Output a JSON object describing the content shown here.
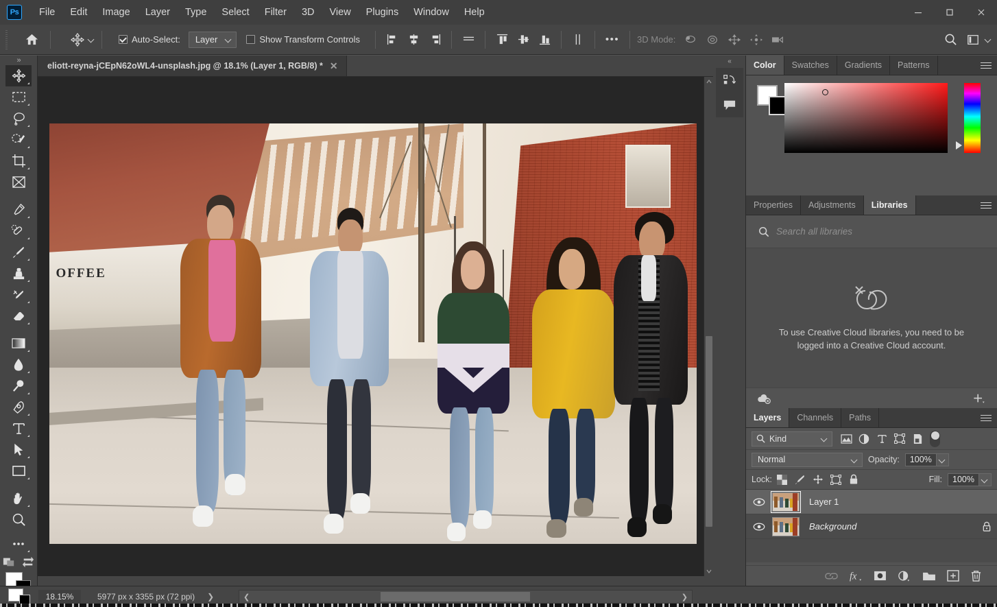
{
  "app": {
    "logo_text": "Ps",
    "menus": [
      "File",
      "Edit",
      "Image",
      "Layer",
      "Type",
      "Select",
      "Filter",
      "3D",
      "View",
      "Plugins",
      "Window",
      "Help"
    ],
    "window_controls": {
      "minimize": "minimize-icon",
      "maximize": "maximize-icon",
      "close": "close-icon"
    }
  },
  "options_bar": {
    "home_icon": "home-icon",
    "tool_icon": "move-tool-icon",
    "auto_select_label": "Auto-Select:",
    "auto_select_checked": true,
    "auto_select_value": "Layer",
    "show_transform_label": "Show Transform Controls",
    "show_transform_checked": false,
    "align_icons": [
      "align-left-edges-icon",
      "align-horizontal-centers-icon",
      "align-right-edges-icon",
      "distribute-horizontal-icon"
    ],
    "align_icons2": [
      "align-top-edges-icon",
      "align-vertical-centers-icon",
      "align-bottom-edges-icon",
      "distribute-vertical-icon"
    ],
    "more_label": "•••",
    "mode3d_label": "3D Mode:",
    "mode3d_icons": [
      "3d-orbit-icon",
      "3d-roll-icon",
      "3d-pan-icon",
      "3d-slide-icon",
      "3d-camera-icon"
    ],
    "search_icon": "search-icon",
    "workspace_icon": "workspace-switcher-icon",
    "workspace_chevron": "chevron-down-icon"
  },
  "document": {
    "tab_title": "eliott-reyna-jCEpN62oWL4-unsplash.jpg @ 18.1% (Layer 1, RGB/8) *",
    "close_icon": "close-icon"
  },
  "toolbar": {
    "grip": "»",
    "tools": [
      {
        "name": "move-tool",
        "icon": "move-icon",
        "active": true,
        "has_corner": true
      },
      {
        "name": "rectangular-marquee-tool",
        "icon": "marquee-icon",
        "active": false,
        "has_corner": true
      },
      {
        "name": "lasso-tool",
        "icon": "lasso-icon",
        "active": false,
        "has_corner": true
      },
      {
        "name": "object-selection-tool",
        "icon": "quick-selection-icon",
        "active": false,
        "has_corner": true
      },
      {
        "name": "crop-tool",
        "icon": "crop-icon",
        "active": false,
        "has_corner": true
      },
      {
        "name": "frame-tool",
        "icon": "frame-icon",
        "active": false,
        "has_corner": false
      },
      {
        "name": "eyedropper-tool",
        "icon": "eyedropper-icon",
        "active": false,
        "has_corner": true
      },
      {
        "name": "spot-healing-brush-tool",
        "icon": "healing-brush-icon",
        "active": false,
        "has_corner": true
      },
      {
        "name": "brush-tool",
        "icon": "brush-icon",
        "active": false,
        "has_corner": true
      },
      {
        "name": "clone-stamp-tool",
        "icon": "clone-stamp-icon",
        "active": false,
        "has_corner": true
      },
      {
        "name": "history-brush-tool",
        "icon": "history-brush-icon",
        "active": false,
        "has_corner": true
      },
      {
        "name": "eraser-tool",
        "icon": "eraser-icon",
        "active": false,
        "has_corner": true
      },
      {
        "name": "gradient-tool",
        "icon": "gradient-icon",
        "active": false,
        "has_corner": true
      },
      {
        "name": "blur-tool",
        "icon": "blur-drop-icon",
        "active": false,
        "has_corner": true
      },
      {
        "name": "dodge-tool",
        "icon": "dodge-icon",
        "active": false,
        "has_corner": true
      },
      {
        "name": "pen-tool",
        "icon": "pen-icon",
        "active": false,
        "has_corner": true
      },
      {
        "name": "type-tool",
        "icon": "type-t-icon",
        "active": false,
        "has_corner": true
      },
      {
        "name": "path-selection-tool",
        "icon": "path-arrow-icon",
        "active": false,
        "has_corner": true
      },
      {
        "name": "rectangle-tool",
        "icon": "rectangle-icon",
        "active": false,
        "has_corner": true
      },
      {
        "name": "hand-tool",
        "icon": "hand-icon",
        "active": false,
        "has_corner": true
      },
      {
        "name": "zoom-tool",
        "icon": "magnifier-icon",
        "active": false,
        "has_corner": false
      },
      {
        "name": "edit-toolbar",
        "icon": "ellipsis-icon",
        "active": false,
        "has_corner": true
      }
    ],
    "quick-mask": "quick-mask-icon",
    "screen-mode": "screen-mode-icon",
    "foreground_color": "#ffffff",
    "background_color": "#000000"
  },
  "canvas": {
    "zoom_display": "18.1%",
    "background_color": "#262626",
    "scroll_up_icon": "chevron-up-icon",
    "scroll_down_icon": "chevron-down-icon"
  },
  "rail": {
    "collapse_icon": "double-chevron-icon",
    "buttons": [
      "history-icon",
      "comments-icon"
    ]
  },
  "color_panel": {
    "tabs": [
      {
        "label": "Color",
        "active": true
      },
      {
        "label": "Swatches",
        "active": false
      },
      {
        "label": "Gradients",
        "active": false
      },
      {
        "label": "Patterns",
        "active": false
      }
    ],
    "menu_icon": "panel-menu-icon",
    "foreground_color": "#ffffff",
    "background_color": "#000000",
    "ramp_base_color": "#ff1a1a"
  },
  "libraries_panel": {
    "tabs": [
      {
        "label": "Properties",
        "active": false
      },
      {
        "label": "Adjustments",
        "active": false
      },
      {
        "label": "Libraries",
        "active": true
      }
    ],
    "menu_icon": "panel-menu-icon",
    "search_icon": "search-icon",
    "search_placeholder": "Search all libraries",
    "search_value": "",
    "empty_icon": "creative-cloud-offline-icon",
    "empty_message": "To use Creative Cloud libraries, you need to be logged into a Creative Cloud account.",
    "footer_left_icon": "cloud-offline-icon",
    "footer_right_icon": "add-icon"
  },
  "layers_panel": {
    "tabs": [
      {
        "label": "Layers",
        "active": true
      },
      {
        "label": "Channels",
        "active": false
      },
      {
        "label": "Paths",
        "active": false
      }
    ],
    "menu_icon": "panel-menu-icon",
    "filter_label": "Kind",
    "filter_search_icon": "search-icon",
    "filter_chevron": "chevron-down-icon",
    "filter_icons": [
      "filter-pixel-icon",
      "filter-adjustment-icon",
      "filter-type-icon",
      "filter-shape-icon",
      "filter-smart-object-icon"
    ],
    "filter_toggle": "filter-enable-toggle",
    "blend_mode": "Normal",
    "blend_chevron": "chevron-down-icon",
    "opacity_label": "Opacity:",
    "opacity_value": "100%",
    "lock_label": "Lock:",
    "lock_icons": [
      "lock-transparent-pixels-icon",
      "lock-image-pixels-icon",
      "lock-position-icon",
      "lock-artboard-icon",
      "lock-all-icon"
    ],
    "fill_label": "Fill:",
    "fill_value": "100%",
    "layers": [
      {
        "name": "Layer 1",
        "visible": true,
        "selected": true,
        "locked": false,
        "italic": false,
        "thumb": "photo-thumbnail"
      },
      {
        "name": "Background",
        "visible": true,
        "selected": false,
        "locked": true,
        "italic": true,
        "thumb": "photo-thumbnail"
      }
    ],
    "footer_icons": [
      "link-layers-icon",
      "add-layer-style-icon",
      "add-layer-mask-icon",
      "new-fill-adjustment-icon",
      "new-group-icon",
      "new-layer-icon",
      "delete-layer-icon"
    ]
  },
  "status_bar": {
    "foreground_color": "#ffffff",
    "background_color": "#000000",
    "zoom_value": "18.15%",
    "doc_info": "5977 px x 3355 px (72 ppi)",
    "expand_icon": "chevron-right-icon",
    "scroll_left_icon": "chevron-left-icon",
    "scroll_right_icon": "chevron-right-icon"
  }
}
